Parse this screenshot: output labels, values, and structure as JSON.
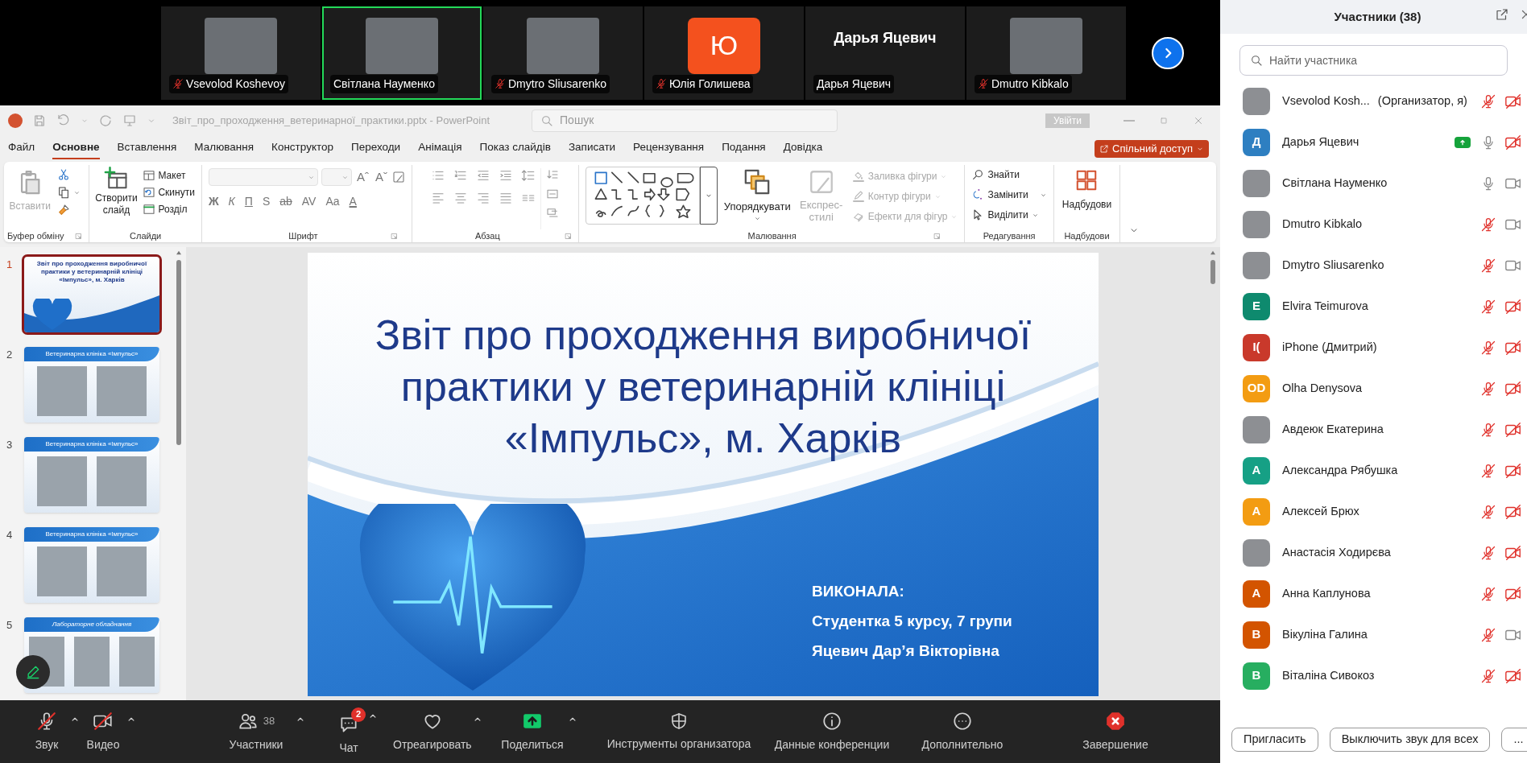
{
  "video_strip": {
    "tiles": [
      {
        "kind": "video",
        "name": "Vsevolod Koshevoy",
        "muted": true,
        "selected": false
      },
      {
        "kind": "video",
        "name": "Світлана Науменко",
        "muted": false,
        "selected": true
      },
      {
        "kind": "video",
        "name": "Dmytro Sliusarenko",
        "muted": true,
        "selected": false
      },
      {
        "kind": "avatar",
        "initial": "Ю",
        "name": "Юлія Голишева",
        "muted": true,
        "selected": false
      },
      {
        "kind": "name",
        "display": "Дарья Яцевич",
        "name": "Дарья Яцевич",
        "muted": false,
        "selected": false
      },
      {
        "kind": "video",
        "name": "Dmutro Kibkalo",
        "muted": true,
        "selected": false
      }
    ]
  },
  "powerpoint": {
    "title_bar": {
      "window_title": "Звіт_про_проходження_ветеринарної_практики.pptx - PowerPoint",
      "search_placeholder": "Пошук",
      "sign_in": "Увійти"
    },
    "tabs": [
      {
        "label": "Файл",
        "selected": false
      },
      {
        "label": "Основне",
        "selected": true
      },
      {
        "label": "Вставлення",
        "selected": false
      },
      {
        "label": "Малювання",
        "selected": false
      },
      {
        "label": "Конструктор",
        "selected": false
      },
      {
        "label": "Переходи",
        "selected": false
      },
      {
        "label": "Анімація",
        "selected": false
      },
      {
        "label": "Показ слайдів",
        "selected": false
      },
      {
        "label": "Записати",
        "selected": false
      },
      {
        "label": "Рецензування",
        "selected": false
      },
      {
        "label": "Подання",
        "selected": false
      },
      {
        "label": "Довідка",
        "selected": false
      }
    ],
    "share_button": "Спільний доступ",
    "ribbon": {
      "clipboard": {
        "paste": {
          "text": "Вставити",
          "disabled": true
        },
        "label": "Буфер обміну"
      },
      "slides": {
        "new_slide": "Створити слайд",
        "layout": "Макет",
        "reset": "Скинути",
        "section": "Розділ",
        "label": "Слайди"
      },
      "font": {
        "size_buttons": [
          "Aˆ",
          "Aˇ"
        ],
        "format_buttons": [
          "Ж",
          "К",
          "П",
          "S",
          "ab",
          "AV",
          "Aa"
        ],
        "color_button": "A",
        "label": "Шрифт"
      },
      "paragraph": {
        "label": "Абзац"
      },
      "drawing": {
        "arrange": {
          "text": "Упорядкувати",
          "disabled": false
        },
        "quick_styles": {
          "text": "Експрес-стилі",
          "disabled": true
        },
        "fill": {
          "text": "Заливка фігури",
          "disabled": true
        },
        "outline": {
          "text": "Контур фігури",
          "disabled": true
        },
        "effects": {
          "text": "Ефекти для фігур",
          "disabled": true
        },
        "label": "Малювання"
      },
      "editing": {
        "find": "Знайти",
        "replace": "Замінити",
        "select": "Виділити",
        "label": "Редагування"
      },
      "addins": {
        "button": "Надбудови",
        "label": "Надбудови"
      }
    },
    "thumbnails": [
      {
        "number": "1",
        "selected": true,
        "kind": "title",
        "title": "Звіт про проходження виробничої практики у ветеринарній клініці «Імпульс», м. Харків"
      },
      {
        "number": "2",
        "selected": false,
        "kind": "two_photos",
        "title": "Ветеринарна клініка «Імпульс»"
      },
      {
        "number": "3",
        "selected": false,
        "kind": "two_photos",
        "title": "Ветеринарна клініка «Імпульс»"
      },
      {
        "number": "4",
        "selected": false,
        "kind": "two_photos",
        "title": "Ветеринарна клініка «Імпульс»"
      },
      {
        "number": "5",
        "selected": false,
        "kind": "three_photos",
        "title": "Лабораторне обладнання"
      }
    ],
    "slide": {
      "title": "Звіт про проходження виробничої практики у ветеринарній клініці «Імпульс», м. Харків",
      "lines": [
        "ВИКОНАЛА:",
        "Студентка 5 курсу, 7 групи",
        "Яцевич Дар’я Вікторівна"
      ]
    }
  },
  "toolbar": [
    {
      "kind": "mic",
      "label": "Звук",
      "off": true,
      "caret": true
    },
    {
      "kind": "video",
      "label": "Видео",
      "off": true,
      "caret": true
    },
    {
      "kind": "participants",
      "label": "Участники",
      "count": "38",
      "caret": true
    },
    {
      "kind": "chat",
      "label": "Чат",
      "badge": "2",
      "caret": true
    },
    {
      "kind": "react",
      "label": "Отреагировать",
      "caret": true
    },
    {
      "kind": "share",
      "label": "Поделиться",
      "caret": true
    },
    {
      "kind": "host",
      "label": "Инструменты организатора",
      "caret": false
    },
    {
      "kind": "info",
      "label": "Данные конференции",
      "caret": false
    },
    {
      "kind": "more",
      "label": "Дополнительно",
      "caret": false
    },
    {
      "kind": "end",
      "label": "Завершение",
      "caret": false
    }
  ],
  "participants_panel": {
    "title": "Участники (38)",
    "search_placeholder": "Найти участника",
    "participants": [
      {
        "kind": "photo",
        "name": "Vsevolod Kosh...",
        "role": "(Организатор, я)",
        "muted": true,
        "camera_off": true,
        "sharing": false
      },
      {
        "kind": "initials",
        "initials": "Д",
        "color": "#2e7fc1",
        "name": "Дарья Яцевич",
        "muted": false,
        "camera_off": true,
        "sharing": true
      },
      {
        "kind": "photo",
        "name": "Світлана Науменко",
        "muted": false,
        "camera_off": false,
        "sharing": false
      },
      {
        "kind": "photo",
        "name": "Dmutro Kibkalo",
        "muted": true,
        "camera_off": false,
        "sharing": false
      },
      {
        "kind": "photo",
        "name": "Dmytro Sliusarenko",
        "muted": true,
        "camera_off": false,
        "sharing": false
      },
      {
        "kind": "initials",
        "initials": "E",
        "color": "#0e8a6e",
        "name": "Elvira Teimurova",
        "muted": true,
        "camera_off": true,
        "sharing": false
      },
      {
        "kind": "initials",
        "initials": "I(",
        "color": "#c9392b",
        "name": "iPhone (Дмитрий)",
        "muted": true,
        "camera_off": true,
        "sharing": false
      },
      {
        "kind": "initials",
        "initials": "OD",
        "color": "#f39c12",
        "name": "Olha Denysova",
        "muted": true,
        "camera_off": true,
        "sharing": false
      },
      {
        "kind": "photo",
        "name": "Авдеюк Екатерина",
        "muted": true,
        "camera_off": true,
        "sharing": false
      },
      {
        "kind": "initials",
        "initials": "А",
        "color": "#16a085",
        "name": "Александра Рябушка",
        "muted": true,
        "camera_off": true,
        "sharing": false
      },
      {
        "kind": "initials",
        "initials": "А",
        "color": "#f39c12",
        "name": "Алексей Брюх",
        "muted": true,
        "camera_off": true,
        "sharing": false
      },
      {
        "kind": "photo",
        "name": "Анастасія Ходирєва",
        "muted": true,
        "camera_off": true,
        "sharing": false
      },
      {
        "kind": "initials",
        "initials": "А",
        "color": "#d35400",
        "name": "Анна Каплунова",
        "muted": true,
        "camera_off": true,
        "sharing": false
      },
      {
        "kind": "initials",
        "initials": "В",
        "color": "#d35400",
        "name": "Вікуліна Галина",
        "muted": true,
        "camera_off": false,
        "sharing": false
      },
      {
        "kind": "initials",
        "initials": "В",
        "color": "#27ae60",
        "name": "Віталіна Сивокоз",
        "muted": true,
        "camera_off": true,
        "sharing": false
      }
    ],
    "buttons": [
      "Пригласить",
      "Выключить звук для всех",
      "..."
    ]
  }
}
